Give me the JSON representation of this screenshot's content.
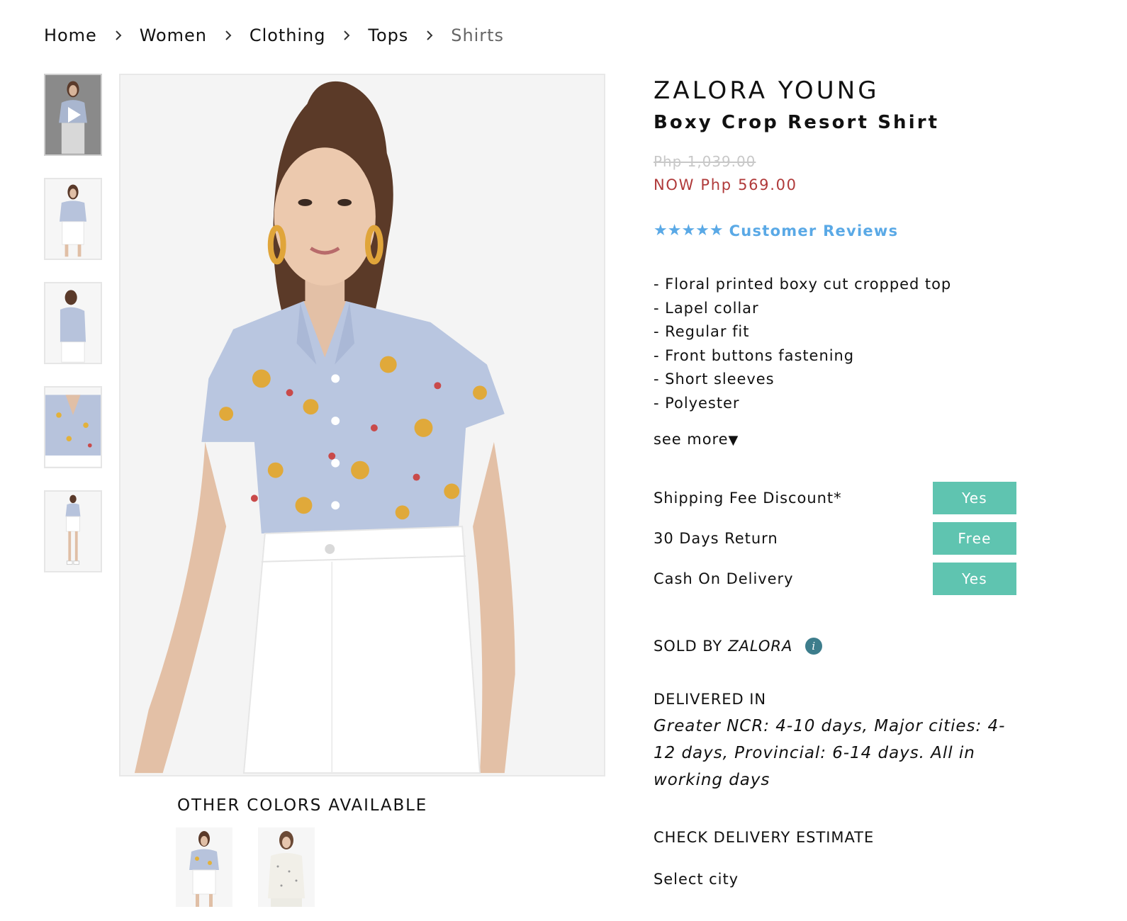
{
  "breadcrumb": [
    {
      "label": "Home"
    },
    {
      "label": "Women"
    },
    {
      "label": "Clothing"
    },
    {
      "label": "Tops"
    },
    {
      "label": "Shirts"
    }
  ],
  "product": {
    "brand": "ZALORA YOUNG",
    "name": "Boxy Crop Resort Shirt",
    "old_price": "Php 1,039.00",
    "now_price": "NOW Php 569.00",
    "stars": "★★★★★",
    "reviews_label": "Customer Reviews",
    "description": [
      "- Floral printed boxy cut cropped top",
      "- Lapel collar",
      "- Regular fit",
      "- Front buttons fastening",
      "- Short sleeves",
      "- Polyester"
    ],
    "see_more": "see more",
    "see_more_icon": "▼"
  },
  "perks": [
    {
      "label": "Shipping Fee Discount*",
      "value": "Yes"
    },
    {
      "label": "30 Days Return",
      "value": "Free"
    },
    {
      "label": "Cash On Delivery",
      "value": "Yes"
    }
  ],
  "sold_by": {
    "prefix": "SOLD BY",
    "seller": "ZALORA",
    "icon": "i"
  },
  "delivery": {
    "title": "DELIVERED IN",
    "text": "Greater NCR: 4-10 days, Major cities: 4-12 days, Provincial: 6-14 days. All in working days"
  },
  "delivery_estimate": {
    "title": "CHECK DELIVERY ESTIMATE",
    "select_label": "Select city"
  },
  "other_colors": {
    "title": "OTHER COLORS AVAILABLE"
  },
  "colors": {
    "accent_teal": "#5fc4b0",
    "price_red": "#b03a3a",
    "review_blue": "#5aa9e6",
    "info_icon": "#3d7d8c"
  }
}
